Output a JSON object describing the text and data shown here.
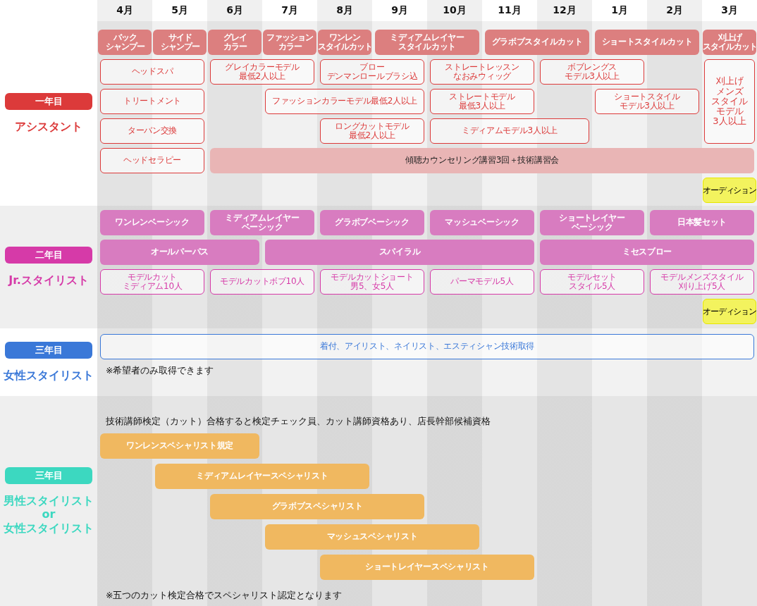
{
  "months": [
    "4月",
    "5月",
    "6月",
    "7月",
    "8月",
    "9月",
    "10月",
    "11月",
    "12月",
    "1月",
    "2月",
    "3月"
  ],
  "sections": [
    {
      "badge": "一年目",
      "title": [
        "アシスタント"
      ],
      "color": "#dc3a3a",
      "lanes": [
        [
          {
            "kind": "fill",
            "color": "#dc7f7f",
            "lines": [
              "バック",
              "シャンプー"
            ]
          },
          {
            "kind": "fill",
            "color": "#dc7f7f",
            "lines": [
              "サイド",
              "シャンプー"
            ]
          },
          {
            "kind": "fill",
            "color": "#dc7f7f",
            "lines": [
              "グレイ",
              "カラー"
            ]
          },
          {
            "kind": "fill",
            "color": "#dc7f7f",
            "lines": [
              "ファッション",
              "カラー"
            ]
          },
          {
            "kind": "fill",
            "color": "#dc7f7f",
            "lines": [
              "ワンレン",
              "スタイルカット"
            ]
          },
          {
            "kind": "fill",
            "color": "#dc7f7f",
            "lines": [
              "ミディアムレイヤー",
              "スタイルカット"
            ]
          },
          {
            "kind": "more"
          },
          {
            "kind": "fill",
            "color": "#dc7f7f",
            "lines": [
              "グラボブスタイルカット"
            ]
          },
          {
            "kind": "more"
          },
          {
            "kind": "fill",
            "color": "#dc7f7f",
            "lines": [
              "ショートスタイルカット"
            ]
          },
          {
            "kind": "more"
          },
          {
            "kind": "fill",
            "color": "#dc7f7f",
            "lines": [
              "刈上げ",
              "スタイルカット"
            ]
          }
        ],
        [
          {
            "kind": "outline",
            "lines": [
              "ヘッドスパ"
            ]
          },
          {
            "kind": "more"
          },
          {
            "kind": "outline",
            "lines": [
              "グレイカラーモデル",
              "最低2人以上"
            ]
          },
          {
            "kind": "more"
          },
          {
            "kind": "outline",
            "lines": [
              "ブロー",
              "デンマンロールブラシ込"
            ]
          },
          {
            "kind": "more"
          },
          {
            "kind": "outline",
            "lines": [
              "ストレートレッスン",
              "なおみウィッグ"
            ]
          },
          {
            "kind": "more"
          },
          {
            "kind": "outline",
            "lines": [
              "ボブレングス",
              "モデル3人以上"
            ]
          },
          {
            "kind": "more"
          },
          {
            "kind": "gap"
          },
          {
            "kind": "column",
            "lines": [
              "刈上げ",
              "メンズ",
              "スタイル",
              "モデル",
              "3人以上"
            ]
          }
        ],
        [
          {
            "kind": "outline",
            "lines": [
              "トリートメント"
            ]
          },
          {
            "kind": "more"
          },
          {
            "kind": "gap"
          },
          {
            "kind": "outline",
            "lines": [
              "ファッションカラーモデル最低2人以上"
            ]
          },
          {
            "kind": "more"
          },
          {
            "kind": "more"
          },
          {
            "kind": "outline",
            "lines": [
              "ストレートモデル",
              "最低3人以上"
            ]
          },
          {
            "kind": "more"
          },
          {
            "kind": "gap"
          },
          {
            "kind": "outline",
            "lines": [
              "ショートスタイル",
              "モデル3人以上"
            ]
          },
          {
            "kind": "more"
          }
        ],
        [
          {
            "kind": "outline",
            "lines": [
              "ターバン交換"
            ]
          },
          {
            "kind": "more"
          },
          {
            "kind": "gap"
          },
          {
            "kind": "gap"
          },
          {
            "kind": "outline",
            "lines": [
              "ロングカットモデル",
              "最低2人以上"
            ]
          },
          {
            "kind": "more"
          },
          {
            "kind": "outline",
            "lines": [
              "ミディアムモデル3人以上"
            ]
          },
          {
            "kind": "more"
          },
          {
            "kind": "more"
          }
        ],
        [
          {
            "kind": "outline",
            "lines": [
              "ヘッドセラピー"
            ]
          },
          {
            "kind": "more"
          },
          {
            "kind": "soft",
            "color": "#e9b5b5",
            "lines": [
              "傾聴カウンセリング講習3回＋技術講習会"
            ]
          },
          {
            "kind": "more"
          },
          {
            "kind": "more"
          },
          {
            "kind": "more"
          },
          {
            "kind": "more"
          },
          {
            "kind": "more"
          },
          {
            "kind": "more"
          },
          {
            "kind": "more"
          },
          {
            "kind": "more"
          },
          {
            "kind": "more"
          }
        ],
        [
          {
            "kind": "gap"
          },
          {
            "kind": "gap"
          },
          {
            "kind": "gap"
          },
          {
            "kind": "gap"
          },
          {
            "kind": "gap"
          },
          {
            "kind": "gap"
          },
          {
            "kind": "gap"
          },
          {
            "kind": "gap"
          },
          {
            "kind": "gap"
          },
          {
            "kind": "gap"
          },
          {
            "kind": "gap"
          },
          {
            "kind": "audition",
            "color": "#f3f35e",
            "lines": [
              "オーディション"
            ]
          }
        ]
      ]
    },
    {
      "badge": "二年目",
      "title": [
        "Jr.スタイリスト"
      ],
      "color": "#d63aa8",
      "lanes": [
        [
          {
            "kind": "fill",
            "color": "#d87cc0",
            "lines": [
              "ワンレンベーシック"
            ]
          },
          {
            "kind": "more"
          },
          {
            "kind": "fill",
            "color": "#d87cc0",
            "lines": [
              "ミディアムレイヤー",
              "ベーシック"
            ]
          },
          {
            "kind": "more"
          },
          {
            "kind": "fill",
            "color": "#d87cc0",
            "lines": [
              "グラボブベーシック"
            ]
          },
          {
            "kind": "more"
          },
          {
            "kind": "fill",
            "color": "#d87cc0",
            "lines": [
              "マッシュベーシック"
            ]
          },
          {
            "kind": "more"
          },
          {
            "kind": "fill",
            "color": "#d87cc0",
            "lines": [
              "ショートレイヤー",
              "ベーシック"
            ]
          },
          {
            "kind": "more"
          },
          {
            "kind": "fill",
            "color": "#d87cc0",
            "lines": [
              "日本髪セット"
            ]
          },
          {
            "kind": "more"
          }
        ],
        [
          {
            "kind": "fill",
            "color": "#d87cc0",
            "lines": [
              "オールパーパス"
            ]
          },
          {
            "kind": "more"
          },
          {
            "kind": "more"
          },
          {
            "kind": "fill",
            "color": "#d87cc0",
            "lines": [
              "スパイラル"
            ]
          },
          {
            "kind": "more"
          },
          {
            "kind": "more"
          },
          {
            "kind": "more"
          },
          {
            "kind": "more"
          },
          {
            "kind": "fill",
            "color": "#d87cc0",
            "lines": [
              "ミセスブロー"
            ]
          },
          {
            "kind": "more"
          },
          {
            "kind": "more"
          },
          {
            "kind": "more"
          }
        ],
        [
          {
            "kind": "outline",
            "lines": [
              "モデルカット",
              "ミディアム10人"
            ]
          },
          {
            "kind": "more"
          },
          {
            "kind": "outline",
            "lines": [
              "モデルカットボブ10人"
            ]
          },
          {
            "kind": "more"
          },
          {
            "kind": "outline",
            "lines": [
              "モデルカットショート",
              "男5、女5人"
            ]
          },
          {
            "kind": "more"
          },
          {
            "kind": "outline",
            "lines": [
              "パーマモデル5人"
            ]
          },
          {
            "kind": "more"
          },
          {
            "kind": "outline",
            "lines": [
              "モデルセット",
              "スタイル5人"
            ]
          },
          {
            "kind": "more"
          },
          {
            "kind": "outline",
            "lines": [
              "モデルメンズスタイル",
              "刈り上げ5人"
            ]
          },
          {
            "kind": "more"
          }
        ],
        [
          {
            "kind": "gap"
          },
          {
            "kind": "gap"
          },
          {
            "kind": "gap"
          },
          {
            "kind": "gap"
          },
          {
            "kind": "gap"
          },
          {
            "kind": "gap"
          },
          {
            "kind": "gap"
          },
          {
            "kind": "gap"
          },
          {
            "kind": "gap"
          },
          {
            "kind": "gap"
          },
          {
            "kind": "gap"
          },
          {
            "kind": "audition",
            "color": "#f3f35e",
            "lines": [
              "オーディション"
            ]
          }
        ]
      ]
    },
    {
      "badge": "三年目",
      "title": [
        "女性スタイリスト"
      ],
      "color": "#3a78d8",
      "lanes": [
        [
          {
            "kind": "outline",
            "lines": [
              "着付、アイリスト、ネイリスト、エスティシャン技術取得"
            ]
          },
          {
            "kind": "more"
          },
          {
            "kind": "more"
          },
          {
            "kind": "more"
          },
          {
            "kind": "more"
          },
          {
            "kind": "more"
          },
          {
            "kind": "more"
          },
          {
            "kind": "more"
          },
          {
            "kind": "more"
          },
          {
            "kind": "more"
          },
          {
            "kind": "more"
          },
          {
            "kind": "more"
          }
        ]
      ],
      "note": "※希望者のみ取得できます"
    },
    {
      "badge": "三年目",
      "title": [
        "男性スタイリスト",
        "or",
        "女性スタイリスト"
      ],
      "color": "#3cd8c0",
      "top_note": "技術講師検定（カット）合格すると検定チェック員、カット講師資格あり、店長幹部候補資格",
      "lanes": [
        [
          {
            "kind": "fill",
            "color": "#f0b860",
            "lines": [
              "ワンレンスペシャリスト規定"
            ]
          },
          {
            "kind": "more"
          },
          {
            "kind": "more"
          }
        ],
        [
          {
            "kind": "gap"
          },
          {
            "kind": "fill",
            "color": "#f0b860",
            "lines": [
              "ミディアムレイヤースペシャリスト"
            ]
          },
          {
            "kind": "more"
          },
          {
            "kind": "more"
          },
          {
            "kind": "more"
          }
        ],
        [
          {
            "kind": "gap"
          },
          {
            "kind": "gap"
          },
          {
            "kind": "fill",
            "color": "#f0b860",
            "lines": [
              "グラボブスペシャリスト"
            ]
          },
          {
            "kind": "more"
          },
          {
            "kind": "more"
          },
          {
            "kind": "more"
          }
        ],
        [
          {
            "kind": "gap"
          },
          {
            "kind": "gap"
          },
          {
            "kind": "gap"
          },
          {
            "kind": "fill",
            "color": "#f0b860",
            "lines": [
              "マッシュスペシャリスト"
            ]
          },
          {
            "kind": "more"
          },
          {
            "kind": "more"
          },
          {
            "kind": "more"
          }
        ],
        [
          {
            "kind": "gap"
          },
          {
            "kind": "gap"
          },
          {
            "kind": "gap"
          },
          {
            "kind": "gap"
          },
          {
            "kind": "fill",
            "color": "#f0b860",
            "lines": [
              "ショートレイヤースペシャリスト"
            ]
          },
          {
            "kind": "more"
          },
          {
            "kind": "more"
          },
          {
            "kind": "more"
          }
        ]
      ],
      "note": "※五つのカット検定合格でスペシャリスト認定となります"
    }
  ]
}
